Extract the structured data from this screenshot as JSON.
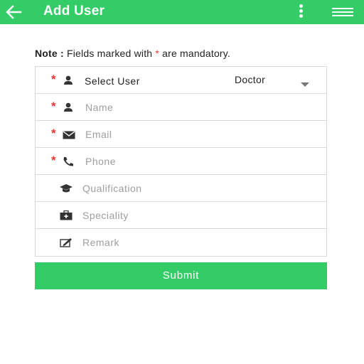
{
  "header": {
    "title": "Add User",
    "back_icon": "arrow-left-icon",
    "more_icon": "more-vertical-icon",
    "menu_icon": "hamburger-menu-icon",
    "background_color": "#33cc66"
  },
  "note": {
    "prefix": "Note :",
    "text_before": "Fields marked with",
    "star": "*",
    "text_after": "are mandatory."
  },
  "form": {
    "required_marker": "*",
    "required_color": "#e53935",
    "fields": [
      {
        "label": "Select User",
        "value": "Doctor",
        "required": true,
        "icon": "person-icon",
        "type": "select"
      },
      {
        "label": "Name",
        "required": true,
        "icon": "person-icon",
        "type": "text"
      },
      {
        "label": "Email",
        "required": true,
        "icon": "envelope-icon",
        "type": "email"
      },
      {
        "label": "Phone",
        "required": true,
        "icon": "phone-icon",
        "type": "tel"
      },
      {
        "label": "Qualification",
        "required": false,
        "icon": "graduation-cap-icon",
        "type": "text"
      },
      {
        "label": "Speciality",
        "required": false,
        "icon": "medical-kit-icon",
        "type": "text"
      },
      {
        "label": "Remark",
        "required": false,
        "icon": "edit-note-icon",
        "type": "text"
      }
    ]
  },
  "submit": {
    "label": "Submit",
    "color": "#33cc66"
  }
}
